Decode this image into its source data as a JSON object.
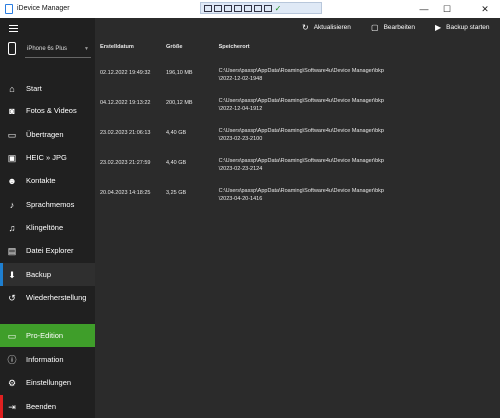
{
  "window": {
    "title": "iDevice Manager",
    "controls": [
      "—",
      "☐",
      "✕"
    ]
  },
  "remote_toolbar_status": "✓",
  "device": {
    "name": "iPhone 6s Plus"
  },
  "sidebar": {
    "items": [
      {
        "label": "Start",
        "icon": "home-icon"
      },
      {
        "label": "Fotos & Videos",
        "icon": "camera-icon"
      },
      {
        "label": "Übertragen",
        "icon": "transfer-icon"
      },
      {
        "label": "HEIC » JPG",
        "icon": "convert-icon"
      },
      {
        "label": "Kontakte",
        "icon": "contacts-icon"
      },
      {
        "label": "Sprachmemos",
        "icon": "microphone-icon"
      },
      {
        "label": "Klingeltöne",
        "icon": "bell-icon"
      },
      {
        "label": "Datei Explorer",
        "icon": "folder-icon"
      },
      {
        "label": "Backup",
        "icon": "download-icon",
        "active": true
      },
      {
        "label": "Wiederherstellung",
        "icon": "history-icon"
      }
    ],
    "bottom": [
      {
        "label": "Pro-Edition",
        "icon": "pro-icon"
      },
      {
        "label": "Information",
        "icon": "info-icon"
      },
      {
        "label": "Einstellungen",
        "icon": "gear-icon"
      },
      {
        "label": "Beenden",
        "icon": "exit-icon"
      }
    ]
  },
  "toolbar": {
    "refresh": "Aktualisieren",
    "edit": "Bearbeiten",
    "start_backup": "Backup starten"
  },
  "table": {
    "headers": [
      "Erstelldatum",
      "Größe",
      "Speicherort"
    ],
    "rows": [
      {
        "date": "02.12.2022 19:49:32",
        "size": "196,10 MB",
        "path1": "C:\\Users\\passp\\AppData\\Roaming\\Software4u\\Device Manager\\bkp",
        "path2": "\\2022-12-02-1948"
      },
      {
        "date": "04.12.2022 19:13:22",
        "size": "200,12 MB",
        "path1": "C:\\Users\\passp\\AppData\\Roaming\\Software4u\\Device Manager\\bkp",
        "path2": "\\2022-12-04-1912"
      },
      {
        "date": "23.02.2023 21:06:13",
        "size": "4,40 GB",
        "path1": "C:\\Users\\passp\\AppData\\Roaming\\Software4u\\Device Manager\\bkp",
        "path2": "\\2023-02-23-2100"
      },
      {
        "date": "23.02.2023 21:27:59",
        "size": "4,40 GB",
        "path1": "C:\\Users\\passp\\AppData\\Roaming\\Software4u\\Device Manager\\bkp",
        "path2": "\\2023-02-23-2124"
      },
      {
        "date": "20.04.2023 14:18:25",
        "size": "3,25 GB",
        "path1": "C:\\Users\\passp\\AppData\\Roaming\\Software4u\\Device Manager\\bkp",
        "path2": "\\2023-04-20-1416"
      }
    ]
  },
  "colors": {
    "active_accent": "#1e7fd0",
    "pro_green": "#3f9e2a",
    "quit_red": "#e02020"
  }
}
